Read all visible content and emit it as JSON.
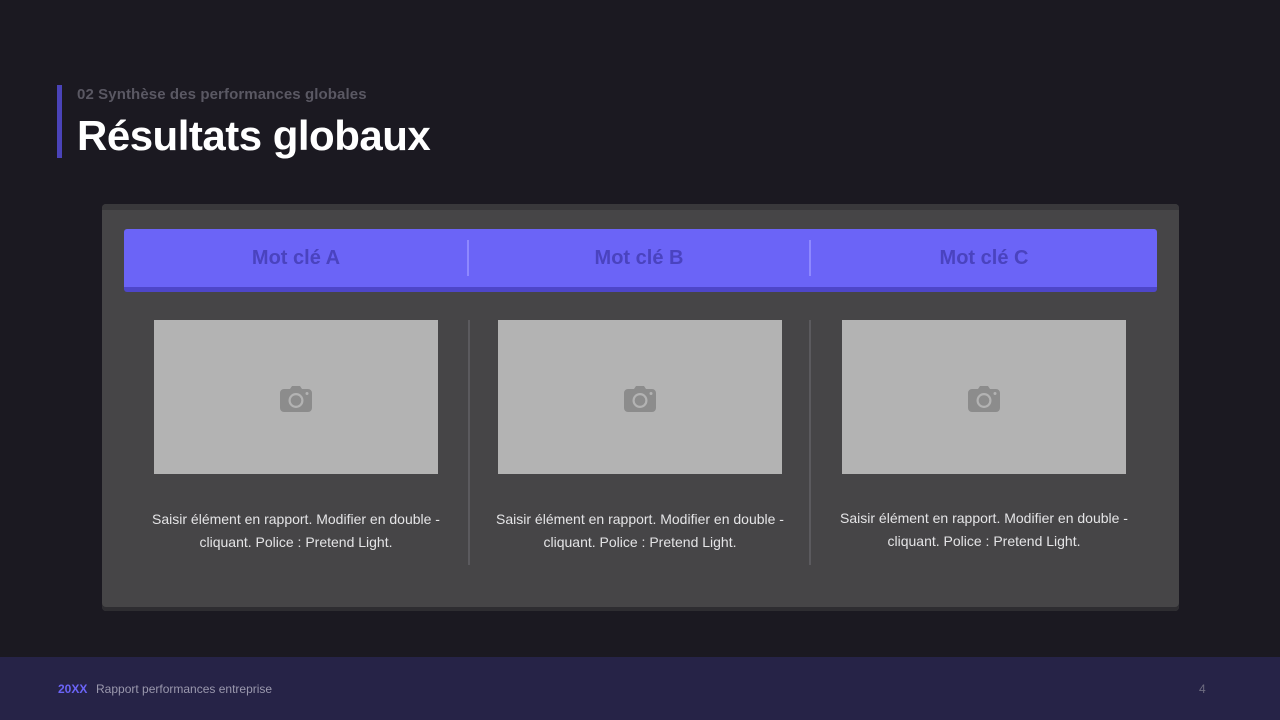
{
  "header": {
    "section": "02 Synthèse des performances globales",
    "title": "Résultats globaux"
  },
  "keywords": [
    {
      "label": "Mot clé A"
    },
    {
      "label": "Mot clé B"
    },
    {
      "label": "Mot clé C"
    }
  ],
  "columns": [
    {
      "image_icon": "camera-icon",
      "text": "Saisir élément en rapport. Modifier en double -cliquant. Police : Pretend Light."
    },
    {
      "image_icon": "camera-icon",
      "text": "Saisir élément en rapport. Modifier en double -cliquant. Police : Pretend Light."
    },
    {
      "image_icon": "camera-icon",
      "text": "Saisir élément en rapport. Modifier en double -cliquant. Police : Pretend Light."
    }
  ],
  "footer": {
    "year": "20XX",
    "report": "Rapport performances entreprise",
    "page": "4"
  },
  "colors": {
    "accent": "#6b64f7",
    "accent_dark": "#4a43bf",
    "background": "#1b1921",
    "panel": "#464547",
    "footer": "#262347"
  }
}
